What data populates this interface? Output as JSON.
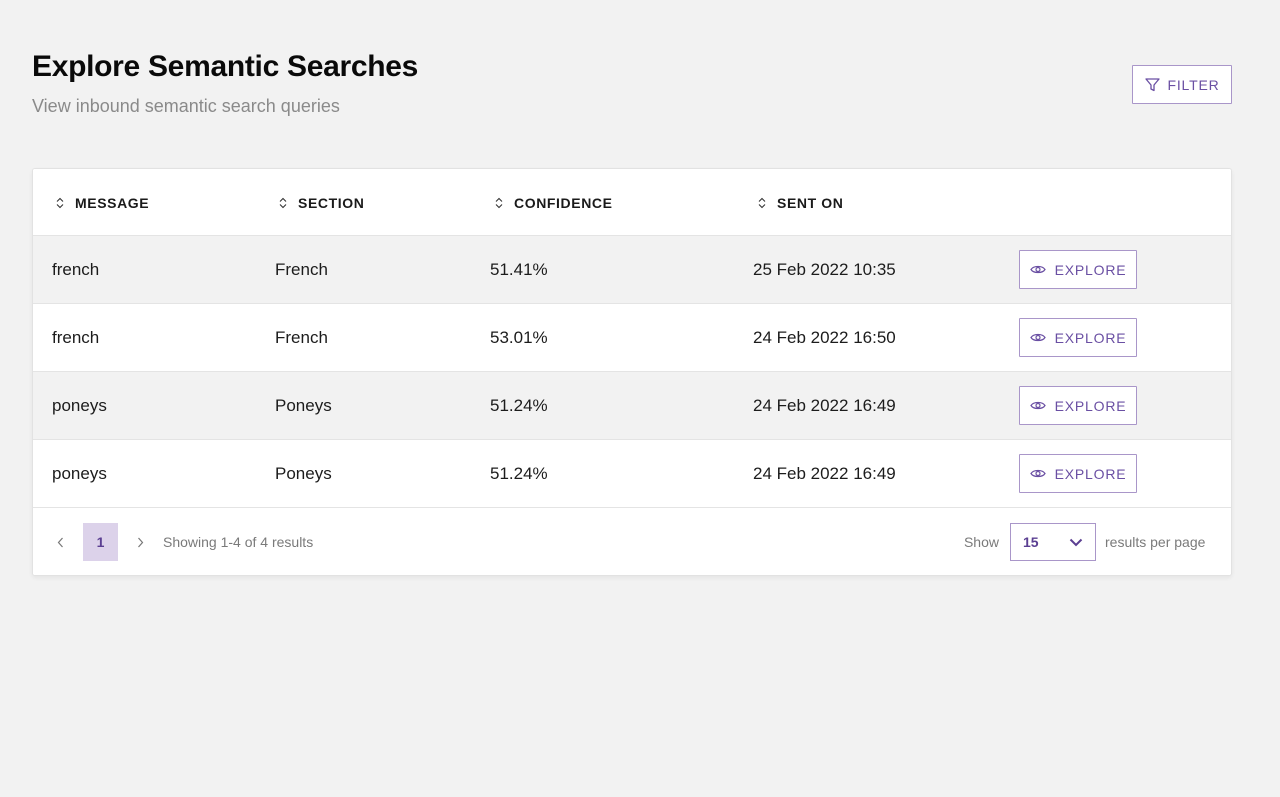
{
  "header": {
    "title": "Explore Semantic Searches",
    "subtitle": "View inbound semantic search queries",
    "filter_label": "FILTER",
    "filter_icon": "funnel-icon"
  },
  "table": {
    "columns": [
      {
        "label": "MESSAGE",
        "sortable": true
      },
      {
        "label": "SECTION",
        "sortable": true
      },
      {
        "label": "CONFIDENCE",
        "sortable": true
      },
      {
        "label": "SENT ON",
        "sortable": true
      }
    ],
    "rows": [
      {
        "message": "french",
        "section": "French",
        "confidence": "51.41%",
        "sent_on": "25 Feb 2022 10:35",
        "action": "EXPLORE"
      },
      {
        "message": "french",
        "section": "French",
        "confidence": "53.01%",
        "sent_on": "24 Feb 2022 16:50",
        "action": "EXPLORE"
      },
      {
        "message": "poneys",
        "section": "Poneys",
        "confidence": "51.24%",
        "sent_on": "24 Feb 2022 16:49",
        "action": "EXPLORE"
      },
      {
        "message": "poneys",
        "section": "Poneys",
        "confidence": "51.24%",
        "sent_on": "24 Feb 2022 16:49",
        "action": "EXPLORE"
      }
    ],
    "action_icon": "eye-icon"
  },
  "pagination": {
    "current_page": "1",
    "results_text": "Showing 1-4 of 4 results",
    "show_label": "Show",
    "per_page_value": "15",
    "per_page_suffix": "results per page"
  },
  "colors": {
    "accent": "#6a4fa3",
    "accent_border": "#a996c9",
    "page_active_bg": "#dcd2ea",
    "background": "#f2f2f2",
    "row_shaded": "#f2f2f2"
  }
}
